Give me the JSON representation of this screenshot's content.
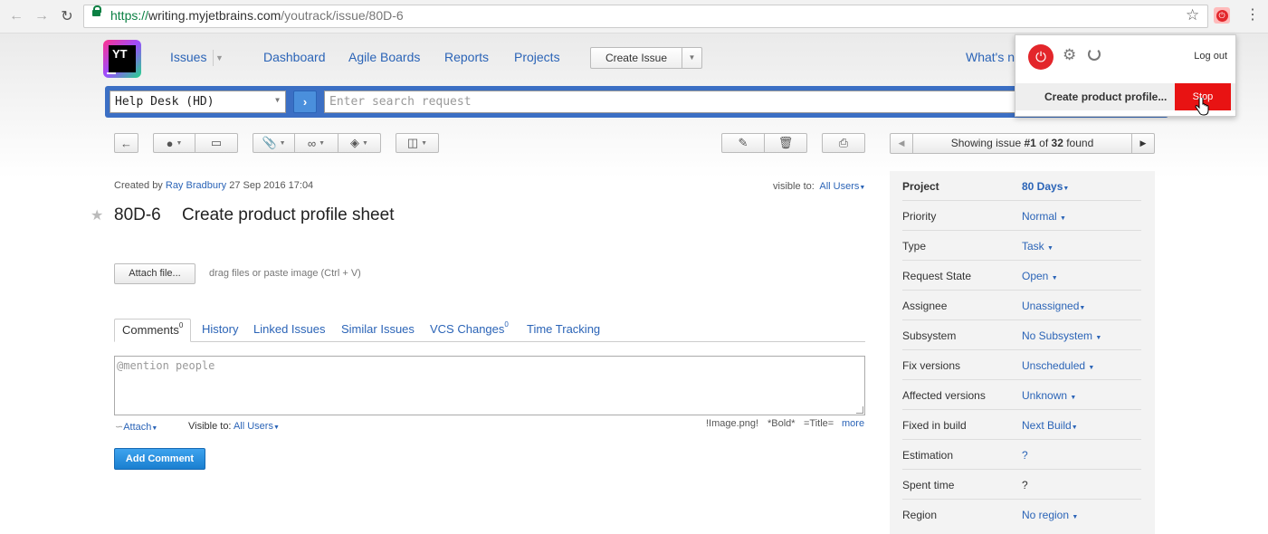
{
  "browser": {
    "url_scheme": "https://",
    "url_host": "writing.myjetbrains.com",
    "url_path": "/youtrack/issue/80D-6"
  },
  "header": {
    "logo_text": "YT",
    "nav": [
      "Issues",
      "Dashboard",
      "Agile Boards",
      "Reports",
      "Projects"
    ],
    "create_issue": "Create Issue",
    "whats_new": "What's new"
  },
  "search": {
    "project": "Help Desk (HD)",
    "placeholder": "Enter search request"
  },
  "pager": {
    "text_prefix": "Showing issue ",
    "current": "#1",
    "text_of": " of ",
    "total": "32",
    "text_suffix": " found"
  },
  "issue": {
    "created_by_label": "Created by",
    "author": "Ray Bradbury",
    "created_at": "27 Sep 2016 17:04",
    "visible_to_label": "visible to:",
    "visible_to": "All Users",
    "id": "80D-6",
    "title": "Create product profile sheet",
    "attach_label": "Attach file...",
    "drag_hint": "drag files or paste image (Ctrl + V)"
  },
  "tabs": [
    {
      "label": "Comments",
      "count": "0"
    },
    {
      "label": "History"
    },
    {
      "label": "Linked Issues"
    },
    {
      "label": "Similar Issues"
    },
    {
      "label": "VCS Changes",
      "count": "0"
    },
    {
      "label": "Time Tracking"
    }
  ],
  "comment": {
    "placeholder": "@mention people",
    "attach": "Attach",
    "visible_label": "Visible to:",
    "visible_value": "All Users",
    "hint_image": "!Image.png!",
    "hint_bold": "*Bold*",
    "hint_title": "=Title=",
    "more": "more",
    "add_button": "Add Comment"
  },
  "fields": [
    {
      "name": "Project",
      "value": "80 Days"
    },
    {
      "name": "Priority",
      "value": "Normal"
    },
    {
      "name": "Type",
      "value": "Task"
    },
    {
      "name": "Request State",
      "value": "Open"
    },
    {
      "name": "Assignee",
      "value": "Unassigned"
    },
    {
      "name": "Subsystem",
      "value": "No Subsystem"
    },
    {
      "name": "Fix versions",
      "value": "Unscheduled"
    },
    {
      "name": "Affected versions",
      "value": "Unknown"
    },
    {
      "name": "Fixed in build",
      "value": "Next Build"
    },
    {
      "name": "Estimation",
      "value": "?"
    },
    {
      "name": "Spent time",
      "value": "?"
    },
    {
      "name": "Region",
      "value": "No region"
    }
  ],
  "popup": {
    "logout": "Log out",
    "task": "Create product profile...",
    "stop": "Stop"
  },
  "colors": {
    "link": "#2b64b7",
    "search_bar": "#3b6fc4",
    "stop_red": "#e81313",
    "add_comment_blue": "#1a7fd0"
  }
}
